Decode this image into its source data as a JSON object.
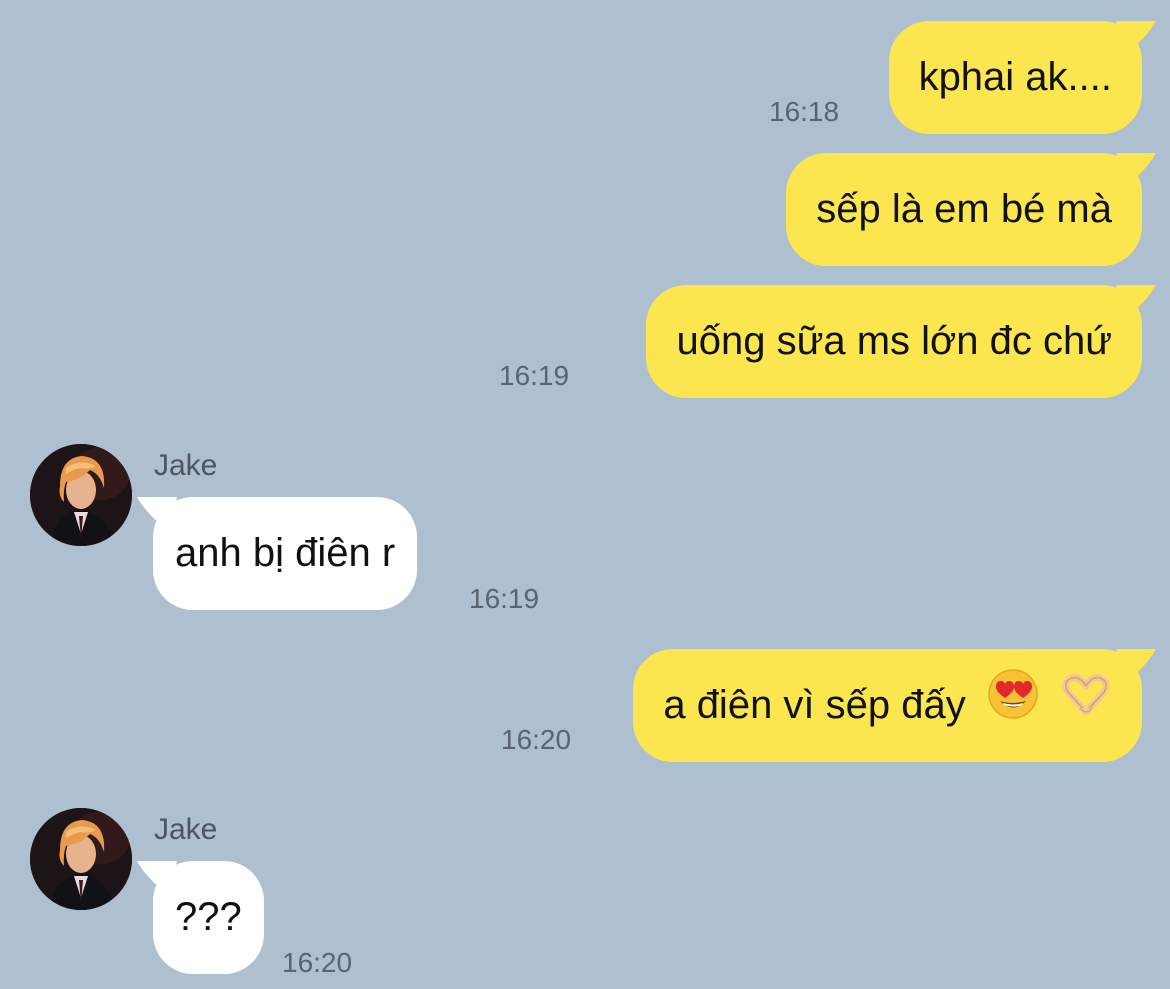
{
  "messages": [
    {
      "side": "out",
      "text": "kphai ak....",
      "time": "16:18"
    },
    {
      "side": "out",
      "text": "sếp là em bé mà",
      "time": ""
    },
    {
      "side": "out",
      "text": "uống sữa ms lớn đc chứ",
      "time": "16:19"
    },
    {
      "side": "in",
      "sender": "Jake",
      "text": "anh bị điên r",
      "time": "16:19"
    },
    {
      "side": "out",
      "text": "a điên vì sếp đấy",
      "emojis": [
        "heart-eyes-emoji",
        "heart-hands-emoji"
      ],
      "time": "16:20"
    },
    {
      "side": "in",
      "sender": "Jake",
      "text": "???",
      "time": "16:20"
    }
  ],
  "colors": {
    "background": "#aebfcf",
    "outgoing_bubble": "#fbe64f",
    "incoming_bubble": "#ffffff"
  }
}
